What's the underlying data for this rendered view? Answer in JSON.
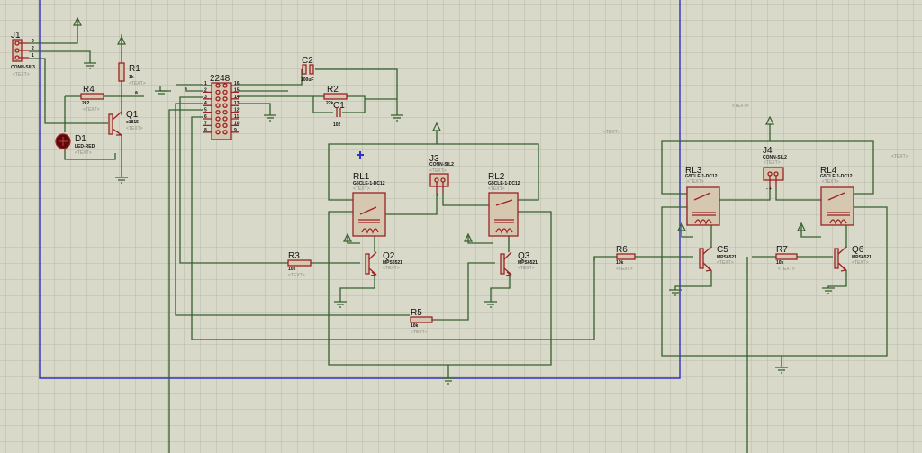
{
  "colors": {
    "background": "#d9d9c9",
    "grid": "#b9b9ab",
    "wire": "#35602f",
    "component": "#9a2222",
    "sheet_border": "#3030c0"
  },
  "placeholder": "<TEXT>",
  "components": {
    "J1": {
      "ref": "J1",
      "value": "CONN-SIL3",
      "pins": [
        "9",
        "2",
        "1"
      ]
    },
    "R1": {
      "ref": "R1",
      "value": "1k"
    },
    "R4": {
      "ref": "R4",
      "value": "2k2"
    },
    "Q1": {
      "ref": "Q1",
      "value": "c1815"
    },
    "D1": {
      "ref": "D1",
      "value": "LED-RED"
    },
    "U1": {
      "ref": "2248",
      "pins_left": [
        "1",
        "2",
        "3",
        "4",
        "5",
        "6",
        "7",
        "8"
      ],
      "pins_right": [
        "16",
        "15",
        "14",
        "13",
        "12",
        "11",
        "10",
        "9"
      ]
    },
    "C2": {
      "ref": "C2",
      "value": "100uF"
    },
    "R2": {
      "ref": "R2",
      "value": "22k"
    },
    "C1": {
      "ref": "C1",
      "value": "102"
    },
    "J3": {
      "ref": "J3",
      "value": "CONN-SIL2",
      "pins": "- +"
    },
    "RL1": {
      "ref": "RL1",
      "value": "G5CLE-1-DC12"
    },
    "RL2": {
      "ref": "RL2",
      "value": "G5CLE-1-DC12"
    },
    "R3": {
      "ref": "R3",
      "value": "10k"
    },
    "Q2": {
      "ref": "Q2",
      "value": "MPS6521"
    },
    "Q3": {
      "ref": "Q3",
      "value": "MPS6521"
    },
    "R5": {
      "ref": "R5",
      "value": "10k"
    },
    "J4": {
      "ref": "J4",
      "value": "CONN-SIL2",
      "pins": "- +"
    },
    "RL3": {
      "ref": "RL3",
      "value": "G5CLE-1-DC12"
    },
    "RL4": {
      "ref": "RL4",
      "value": "G5CLE-1-DC12"
    },
    "R6": {
      "ref": "R6",
      "value": "10k"
    },
    "C5": {
      "ref": "C5",
      "value": "MPS6521"
    },
    "R7": {
      "ref": "R7",
      "value": "10k"
    },
    "Q6": {
      "ref": "Q6",
      "value": "MPS6521"
    }
  },
  "net_labels": {
    "a1": "a",
    "a2": "a"
  }
}
